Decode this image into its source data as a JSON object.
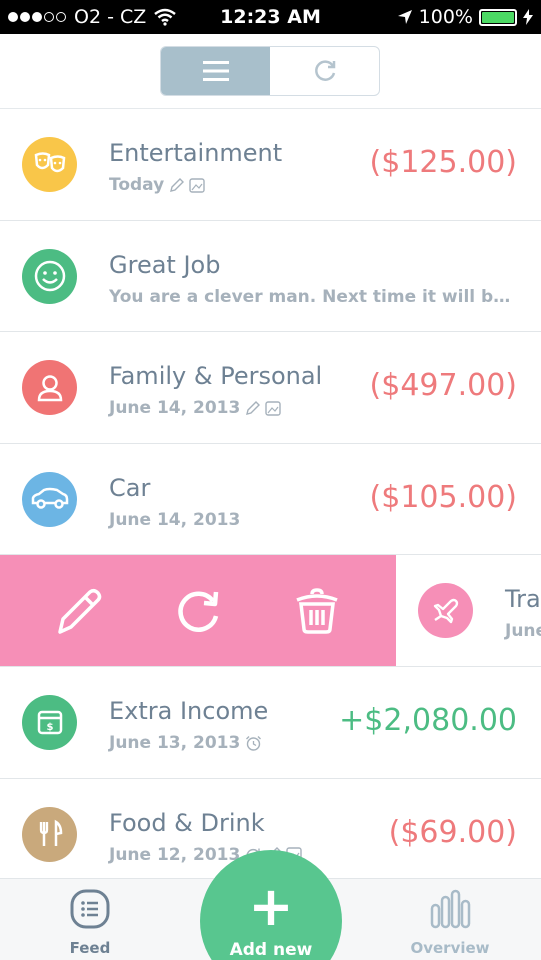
{
  "status_bar": {
    "carrier": "O2 - CZ",
    "time": "12:23 AM",
    "battery": "100%",
    "battery_level": 1.0
  },
  "segmented": {
    "options": [
      "list",
      "recurring"
    ],
    "selected": "list"
  },
  "transactions": [
    {
      "title": "Entertainment",
      "subtitle": "Today",
      "amount": "($125.00)",
      "type": "expense",
      "color": "#f9c649",
      "icon": "theater-masks-icon"
    },
    {
      "title": "Great Job",
      "subtitle": "You are a clever man. Next time it will be tou...",
      "amount": "",
      "type": "message",
      "color": "#4cbc83",
      "icon": "smiley-icon"
    },
    {
      "title": "Family & Personal",
      "subtitle": "June 14, 2013",
      "amount": "($497.00)",
      "type": "expense",
      "color": "#f07474",
      "icon": "person-icon"
    },
    {
      "title": "Car",
      "subtitle": "June 14, 2013",
      "amount": "($105.00)",
      "type": "expense",
      "color": "#6cb5e4",
      "icon": "car-icon"
    },
    {
      "title": "Tra",
      "subtitle": "June",
      "amount": "",
      "type": "expense",
      "color": "#f68fb7",
      "icon": "airplane-icon"
    },
    {
      "title": "Extra Income",
      "subtitle": "June 13, 2013",
      "amount": "+$2,080.00",
      "type": "income",
      "color": "#4cbc83",
      "icon": "cash-register-icon"
    },
    {
      "title": "Food & Drink",
      "subtitle": "June 12, 2013",
      "amount": "($69.00)",
      "type": "expense",
      "color": "#c9a97c",
      "icon": "fork-knife-icon"
    }
  ],
  "tab_bar": {
    "feed": "Feed",
    "add_new": "Add new",
    "overview": "Overview"
  },
  "colors": {
    "expense": "#ee7a7c",
    "income": "#4cbc83",
    "swipe_action_bg": "#f68fb7",
    "add_button": "#58c68f"
  }
}
